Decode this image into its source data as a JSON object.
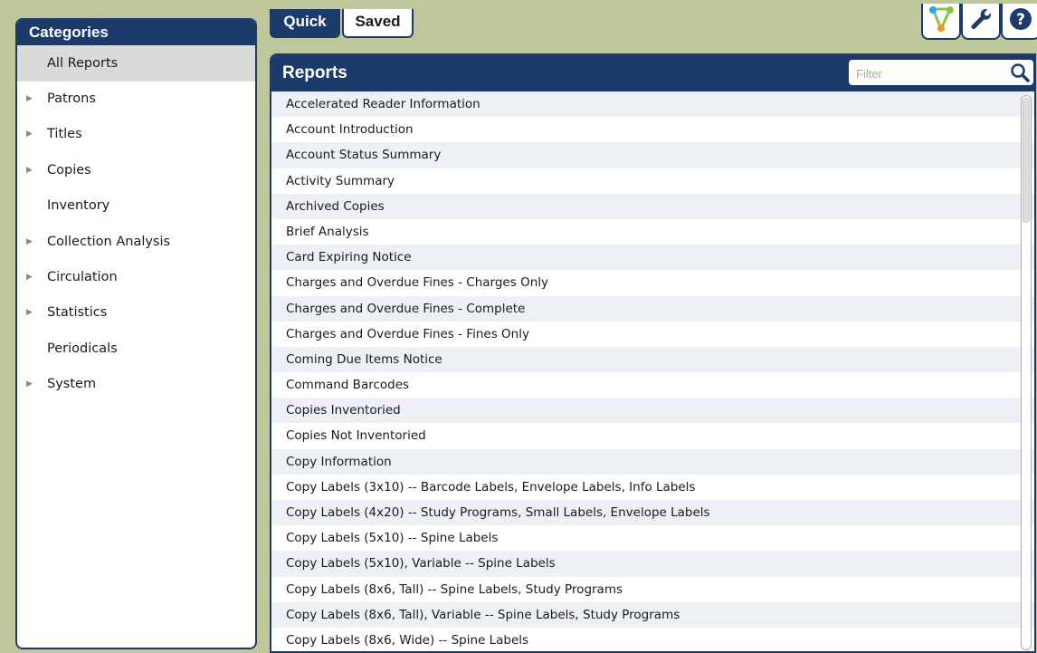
{
  "sidebar": {
    "title": "Categories",
    "items": [
      {
        "label": "All Reports",
        "expandable": false,
        "selected": true
      },
      {
        "label": "Patrons",
        "expandable": true
      },
      {
        "label": "Titles",
        "expandable": true
      },
      {
        "label": "Copies",
        "expandable": true
      },
      {
        "label": "Inventory",
        "expandable": false
      },
      {
        "label": "Collection Analysis",
        "expandable": true
      },
      {
        "label": "Circulation",
        "expandable": true
      },
      {
        "label": "Statistics",
        "expandable": true
      },
      {
        "label": "Periodicals",
        "expandable": false
      },
      {
        "label": "System",
        "expandable": true
      }
    ]
  },
  "tabs": {
    "quick": "Quick",
    "saved": "Saved",
    "active": "Quick"
  },
  "toolbar": {
    "icons": [
      "workflow-icon",
      "wrench-icon",
      "help-icon"
    ]
  },
  "reports": {
    "title": "Reports",
    "filter_placeholder": "Filter",
    "filter_value": "",
    "items": [
      "Accelerated Reader Information",
      "Account Introduction",
      "Account Status Summary",
      "Activity Summary",
      "Archived Copies",
      "Brief Analysis",
      "Card Expiring Notice",
      "Charges and Overdue Fines - Charges Only",
      "Charges and Overdue Fines - Complete",
      "Charges and Overdue Fines - Fines Only",
      "Coming Due Items Notice",
      "Command Barcodes",
      "Copies Inventoried",
      "Copies Not Inventoried",
      "Copy Information",
      "Copy Labels (3x10) -- Barcode Labels, Envelope Labels, Info Labels",
      "Copy Labels (4x20) -- Study Programs, Small Labels, Envelope Labels",
      "Copy Labels (5x10) -- Spine Labels",
      "Copy Labels (5x10), Variable -- Spine Labels",
      "Copy Labels (8x6, Tall) -- Spine Labels, Study Programs",
      "Copy Labels (8x6, Tall), Variable -- Spine Labels, Study Programs",
      "Copy Labels (8x6, Wide) -- Spine Labels"
    ]
  },
  "colors": {
    "background": "#bec79a",
    "navy": "#1c3b6b",
    "row_alt": "#edf1f5",
    "selected": "#dadada"
  }
}
